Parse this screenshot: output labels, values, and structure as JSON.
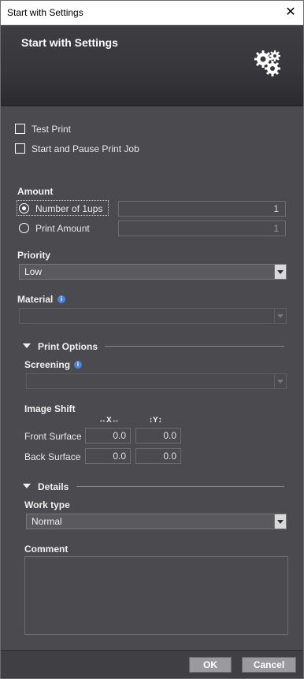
{
  "window": {
    "title": "Start with Settings",
    "close_glyph": "✕"
  },
  "header": {
    "title": "Start with Settings",
    "icon": "gears-icon"
  },
  "options": {
    "test_print": {
      "label": "Test Print",
      "checked": false
    },
    "start_pause": {
      "label": "Start and Pause Print Job",
      "checked": false
    }
  },
  "amount": {
    "title": "Amount",
    "number_of_ups": {
      "label": "Number of 1ups",
      "value": "1",
      "selected": true
    },
    "print_amount": {
      "label": "Print Amount",
      "value": "1",
      "selected": false
    }
  },
  "priority": {
    "title": "Priority",
    "value": "Low"
  },
  "material": {
    "title": "Material",
    "value": ""
  },
  "print_options": {
    "title": "Print Options",
    "screening": {
      "title": "Screening",
      "value": ""
    },
    "image_shift": {
      "title": "Image Shift",
      "x_header": "↔X↔",
      "y_header": "↕Y↕",
      "front": {
        "label": "Front Surface",
        "x": "0.0",
        "y": "0.0"
      },
      "back": {
        "label": "Back Surface",
        "x": "0.0",
        "y": "0.0"
      }
    }
  },
  "details": {
    "title": "Details",
    "work_type": {
      "title": "Work type",
      "value": "Normal"
    },
    "comment": {
      "title": "Comment",
      "value": ""
    }
  },
  "footer": {
    "ok": "OK",
    "cancel": "Cancel"
  },
  "colors": {
    "background": "#4b4b4f",
    "info": "#4a86d8",
    "button": "#9a9a9e"
  }
}
